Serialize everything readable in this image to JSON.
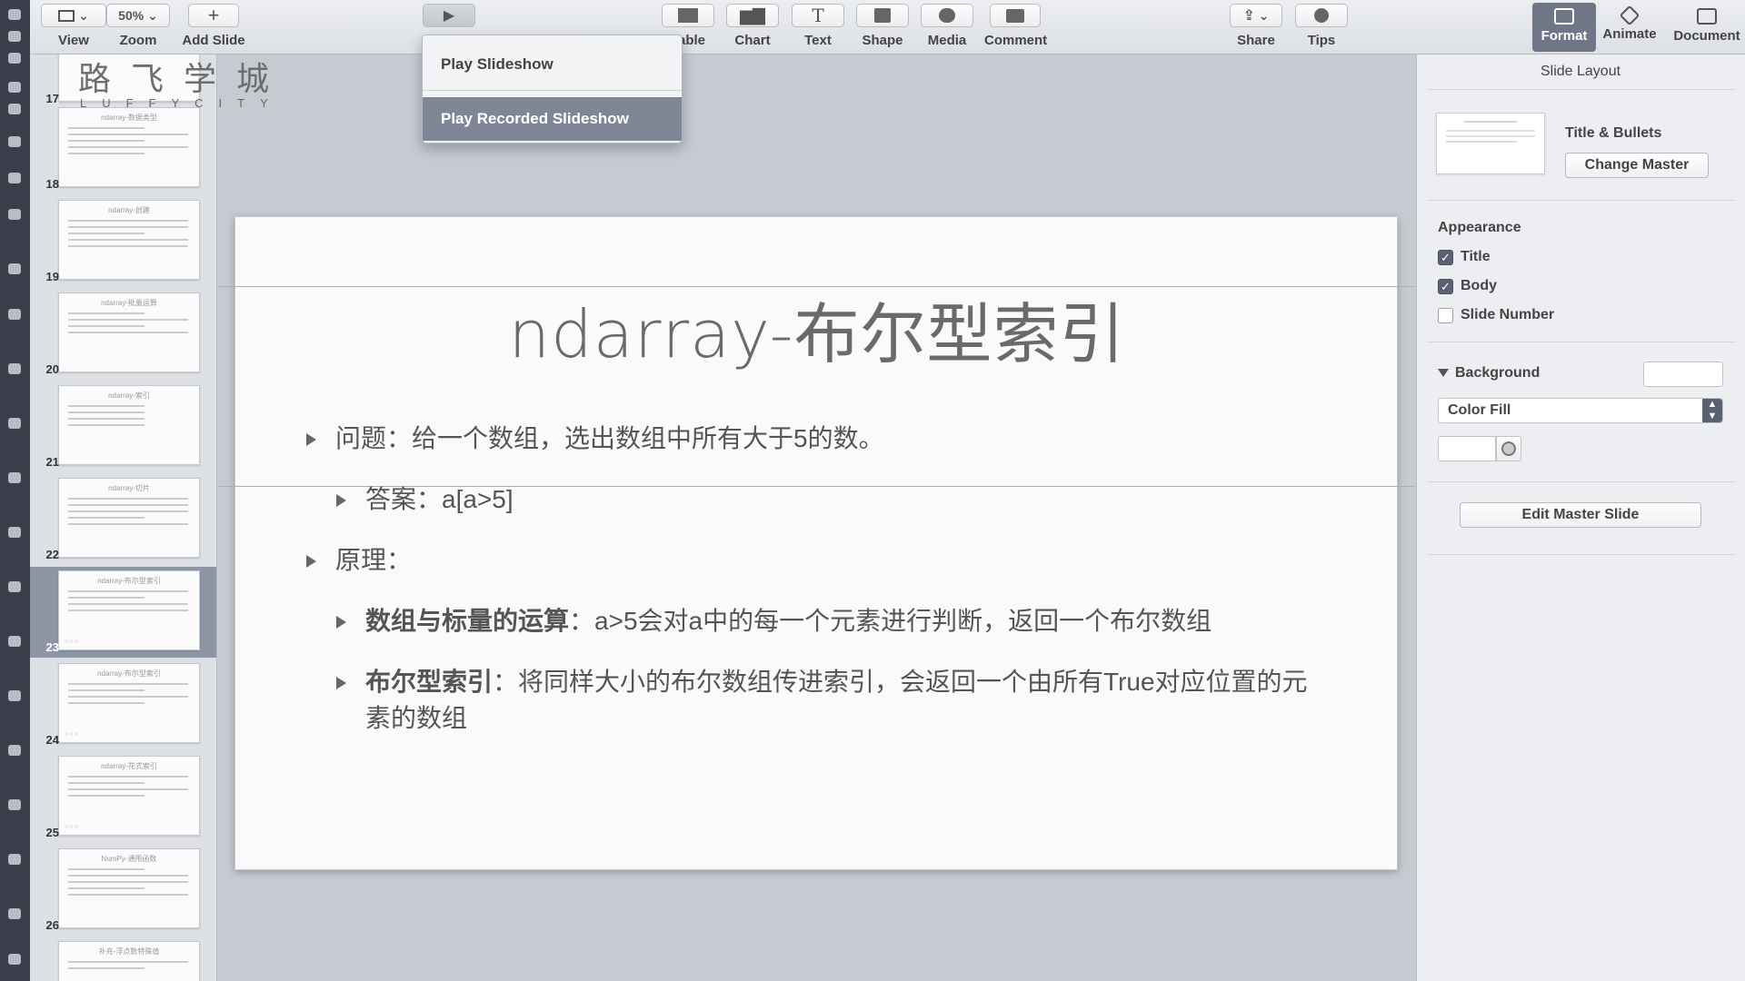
{
  "toolbar": {
    "view": {
      "label": "View"
    },
    "zoom": {
      "value": "50%",
      "label": "Zoom"
    },
    "add_slide": {
      "label": "Add Slide"
    },
    "table": {
      "label": "Table"
    },
    "chart": {
      "label": "Chart"
    },
    "text": {
      "label": "Text"
    },
    "shape": {
      "label": "Shape"
    },
    "media": {
      "label": "Media"
    },
    "comment": {
      "label": "Comment"
    },
    "share": {
      "label": "Share"
    },
    "tips": {
      "label": "Tips"
    },
    "format": {
      "label": "Format"
    },
    "animate": {
      "label": "Animate"
    },
    "document": {
      "label": "Document"
    }
  },
  "play_menu": {
    "items": [
      {
        "label": "Play Slideshow"
      },
      {
        "label": "Play Recorded Slideshow"
      }
    ]
  },
  "navigator": {
    "slides": [
      {
        "num": "17",
        "title": ""
      },
      {
        "num": "18",
        "title": "ndarray-数据类型"
      },
      {
        "num": "19",
        "title": "ndarray-创建"
      },
      {
        "num": "20",
        "title": "ndarray-批量运算"
      },
      {
        "num": "21",
        "title": "ndarray-索引"
      },
      {
        "num": "22",
        "title": "ndarray-切片"
      },
      {
        "num": "23",
        "title": "ndarray-布尔型索引"
      },
      {
        "num": "24",
        "title": "ndarray-布尔型索引"
      },
      {
        "num": "25",
        "title": "ndarray-花式索引"
      },
      {
        "num": "26",
        "title": "NumPy-通用函数"
      },
      {
        "num": "27",
        "title": "补充-浮点数特殊值"
      }
    ]
  },
  "canvas": {
    "logo": "路飞学城",
    "logo_sub": "LUFFYCITY"
  },
  "slide": {
    "title": "ndarray-布尔型索引",
    "bullets": [
      {
        "text": "问题：给一个数组，选出数组中所有大于5的数。"
      },
      {
        "text": "答案：a[a>5]"
      },
      {
        "text": "原理："
      },
      {
        "bold": "数组与标量的运算",
        "text": "：a>5会对a中的每一个元素进行判断，返回一个布尔数组"
      },
      {
        "bold": "布尔型索引",
        "text": "：将同样大小的布尔数组传进索引，会返回一个由所有True对应位置的元",
        "text2": "素的数组"
      }
    ]
  },
  "inspector": {
    "header": "Slide Layout",
    "master_name": "Title & Bullets",
    "change_master": "Change Master",
    "appearance": {
      "title": "Appearance",
      "options": [
        {
          "label": "Title",
          "checked": true
        },
        {
          "label": "Body",
          "checked": true
        },
        {
          "label": "Slide Number",
          "checked": false
        }
      ]
    },
    "background": {
      "title": "Background",
      "fill": "Color Fill"
    },
    "edit_master": "Edit Master Slide"
  }
}
